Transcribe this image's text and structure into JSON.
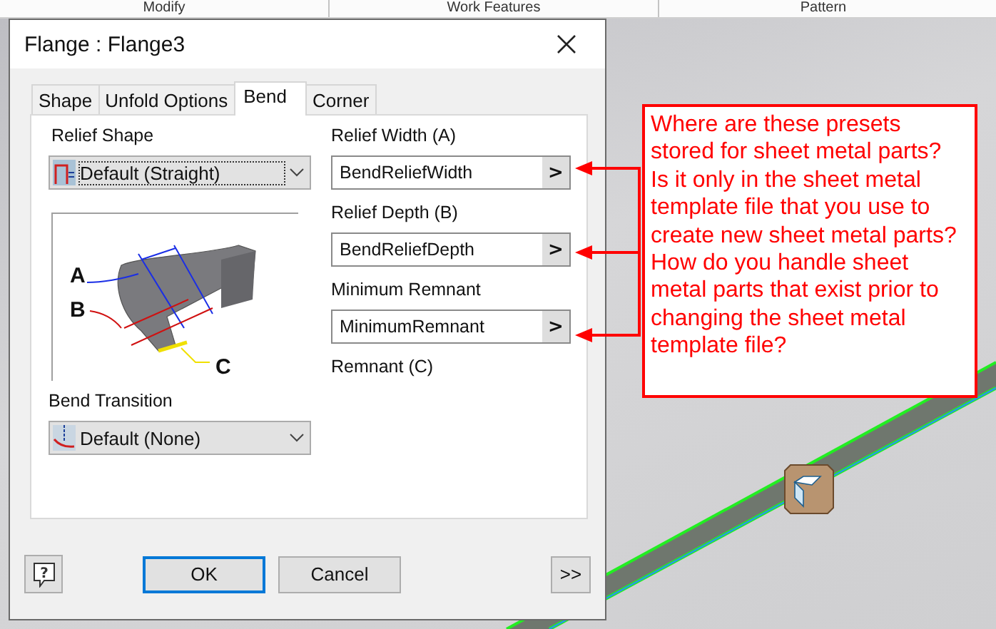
{
  "ribbon": {
    "tabs": [
      "Modify",
      "Work Features",
      "Pattern"
    ]
  },
  "dialog": {
    "title": "Flange : Flange3",
    "tabs": [
      {
        "label": "Shape",
        "selected": false
      },
      {
        "label": "Unfold Options",
        "selected": false
      },
      {
        "label": "Bend",
        "selected": true
      },
      {
        "label": "Corner",
        "selected": false
      }
    ],
    "relief_shape": {
      "label": "Relief Shape",
      "value": "Default (Straight)"
    },
    "diagram": {
      "labels": [
        "A",
        "B",
        "C"
      ]
    },
    "bend_transition": {
      "label": "Bend Transition",
      "value": "Default (None)"
    },
    "parameters": [
      {
        "label": "Relief Width (A)",
        "value": "BendReliefWidth",
        "button": ">"
      },
      {
        "label": "Relief Depth (B)",
        "value": "BendReliefDepth",
        "button": ">"
      },
      {
        "label": "Minimum Remnant",
        "value": "MinimumRemnant",
        "button": ">"
      }
    ],
    "remnant_label": "Remnant (C)",
    "buttons": {
      "help": "?",
      "ok": "OK",
      "cancel": "Cancel",
      "more": ">>"
    }
  },
  "annotation": {
    "text": "Where are these presets stored for sheet metal parts? Is it only in the sheet metal template file that you use to create new sheet metal parts? How do you handle sheet metal parts that exist prior to changing the sheet metal template file?"
  }
}
